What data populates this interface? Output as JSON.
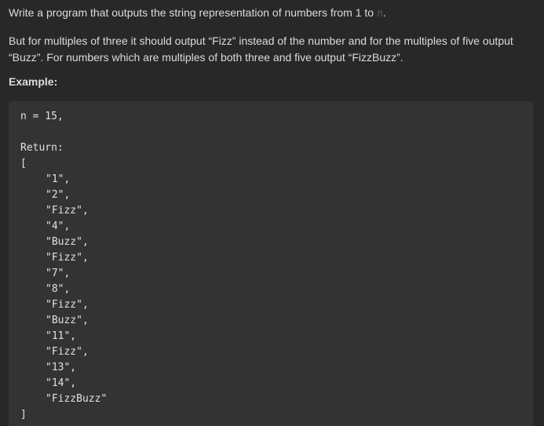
{
  "description": {
    "line1_prefix": "Write a program that outputs the string representation of numbers from 1 to ",
    "line1_var": "n",
    "line1_suffix": ".",
    "paragraph2": "But for multiples of three it should output “Fizz” instead of the number and for the multiples of five output “Buzz”. For numbers which are multiples of both three and five output “FizzBuzz”."
  },
  "example": {
    "heading": "Example:",
    "input_line": "n = 15,",
    "return_label": "Return:",
    "open_bracket": "[",
    "close_bracket": "]",
    "items": [
      "\"1\",",
      "\"2\",",
      "\"Fizz\",",
      "\"4\",",
      "\"Buzz\",",
      "\"Fizz\",",
      "\"7\",",
      "\"8\",",
      "\"Fizz\",",
      "\"Buzz\",",
      "\"11\",",
      "\"Fizz\",",
      "\"13\",",
      "\"14\",",
      "\"FizzBuzz\""
    ]
  }
}
